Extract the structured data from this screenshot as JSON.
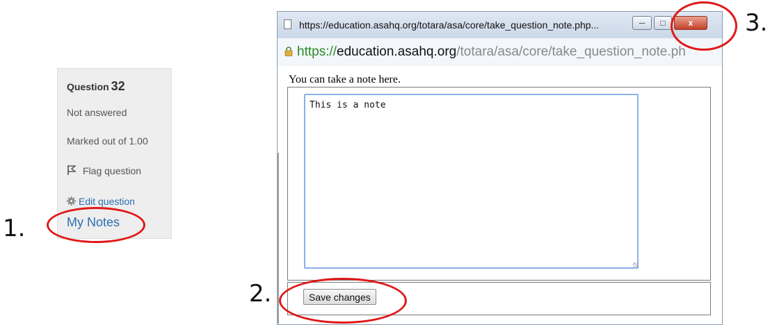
{
  "question_panel": {
    "title_label": "Question",
    "number": "32",
    "status": "Not answered",
    "marks": "Marked out of 1.00",
    "flag_label": "Flag question",
    "edit_label": "Edit question",
    "notes_link": "My Notes"
  },
  "annotations": {
    "step1": "1.",
    "step2": "2.",
    "step3": "3."
  },
  "popup": {
    "title": "https://education.asahq.org/totara/asa/core/take_question_note.php...",
    "url": {
      "scheme": "https://",
      "host": "education.asahq.org",
      "path": "/totara/asa/core/take_question_note.ph"
    },
    "prompt": "You can take a note here.",
    "note_value": "This is a note",
    "save_label": "Save changes",
    "close_label": "x"
  },
  "colors": {
    "link": "#2a6fb0",
    "annotation": "#e01818",
    "secure_url": "#2a8a2a"
  },
  "icons": [
    "flag-icon",
    "gear-icon",
    "page-icon",
    "lock-icon",
    "minimize-icon",
    "maximize-icon",
    "close-icon"
  ]
}
